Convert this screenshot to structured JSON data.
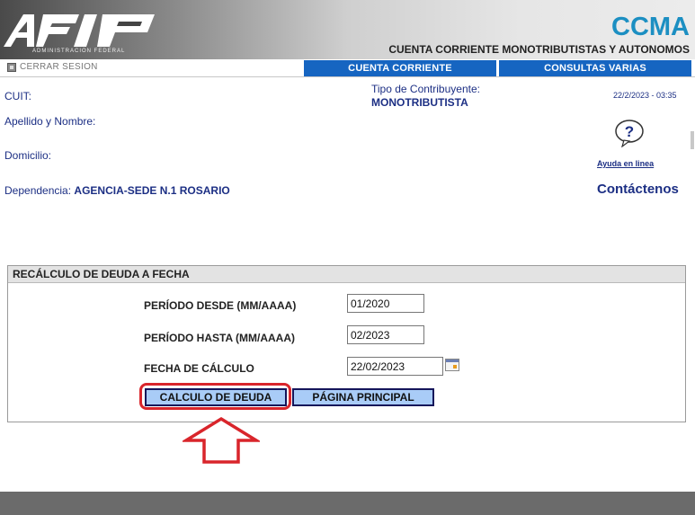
{
  "header": {
    "logo_text": "AFIP",
    "logo_subtext": "ADMINISTRACION FEDERAL",
    "app_name": "CCMA",
    "subtitle": "CUENTA CORRIENTE MONOTRIBUTISTAS Y AUTONOMOS"
  },
  "nav": {
    "logout": "CERRAR SESION",
    "tabs": [
      {
        "label": "CUENTA CORRIENTE"
      },
      {
        "label": "CONSULTAS VARIAS"
      }
    ]
  },
  "info": {
    "cuit_label": "CUIT:",
    "apellido_label": "Apellido y Nombre:",
    "domicilio_label": "Domicilio:",
    "dependencia_label": "Dependencia:",
    "dependencia_value": "AGENCIA-SEDE N.1 ROSARIO",
    "tipo_label": "Tipo de Contribuyente:",
    "tipo_value": "MONOTRIBUTISTA",
    "datetime": "22/2/2023 - 03:35",
    "help_link": "Ayuda en linea",
    "contact": "Contáctenos"
  },
  "form": {
    "title": "RECÁLCULO DE DEUDA A FECHA",
    "periodo_desde_label": "PERÍODO DESDE (MM/AAAA)",
    "periodo_desde_value": "01/2020",
    "periodo_hasta_label": "PERÍODO HASTA (MM/AAAA)",
    "periodo_hasta_value": "02/2023",
    "fecha_label": "FECHA DE CÁLCULO",
    "fecha_value": "22/02/2023",
    "btn_calculo": "CALCULO DE DEUDA",
    "btn_principal": "PÁGINA PRINCIPAL"
  },
  "colors": {
    "accent_blue": "#1665c1",
    "text_navy": "#1c2f84",
    "brand_teal": "#1c8fc2",
    "highlight_red": "#d9252b",
    "button_fill": "#a9ccf7"
  }
}
